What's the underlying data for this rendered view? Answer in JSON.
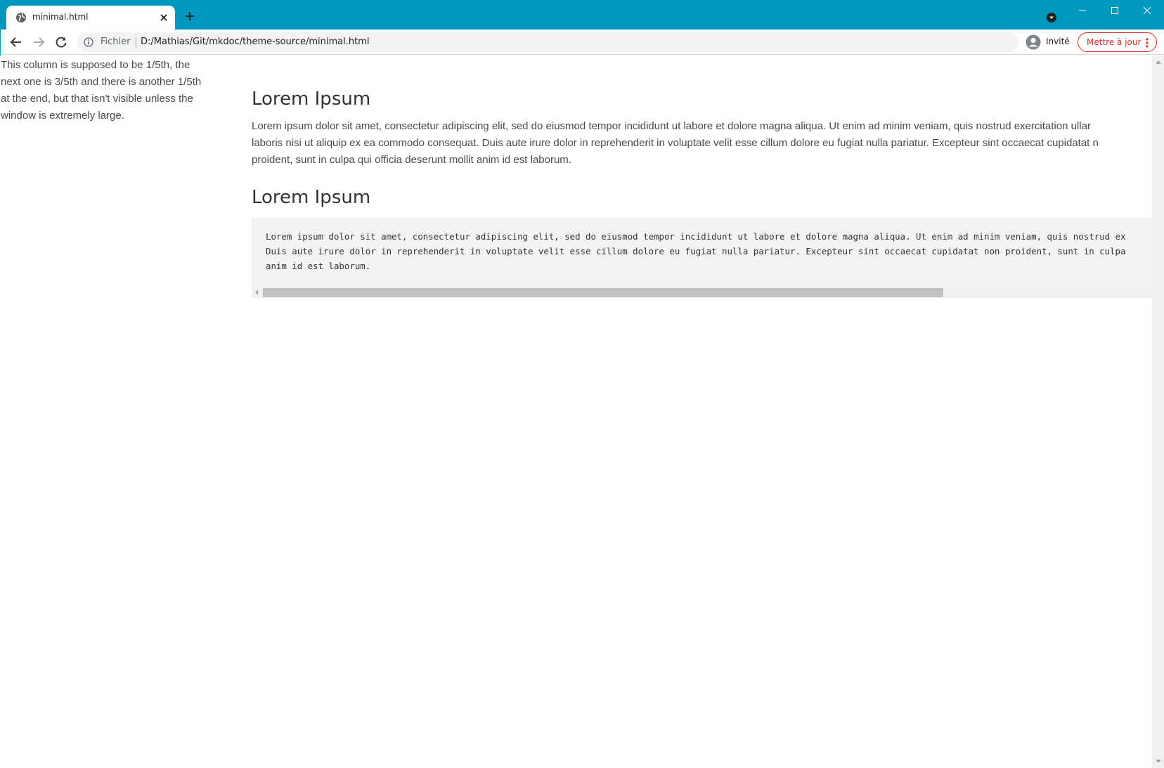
{
  "browser": {
    "tab_title": "minimal.html",
    "omnibox": {
      "scheme_label": "Fichier",
      "url": "D:/Mathias/Git/mkdoc/theme-source/minimal.html"
    },
    "profile_label": "Invité",
    "update_label": "Mettre à jour",
    "accent_color": "#0097bd",
    "update_color": "#d93025",
    "icons": [
      "globe-icon",
      "close-icon",
      "plus-icon",
      "profile-indicator-icon",
      "minimize-icon",
      "maximize-icon",
      "window-close-icon",
      "back-arrow-icon",
      "forward-arrow-icon",
      "reload-icon",
      "info-icon",
      "avatar-icon",
      "kebab-menu-icon"
    ]
  },
  "page": {
    "left_column_lines": [
      "This column is supposed to be 1/5th, the",
      "next one is 3/5th and there is another 1/5th",
      "at the end, but that isn't visible unless the",
      "window is extremely large."
    ],
    "section1": {
      "heading": "Lorem Ipsum",
      "paragraph_lines": [
        "Lorem ipsum dolor sit amet, consectetur adipiscing elit, sed do eiusmod tempor incididunt ut labore et dolore magna aliqua. Ut enim ad minim veniam, quis nostrud exercitation ullar",
        "laboris nisi ut aliquip ex ea commodo consequat. Duis aute irure dolor in reprehenderit in voluptate velit esse cillum dolore eu fugiat nulla pariatur. Excepteur sint occaecat cupidatat n",
        "proident, sunt in culpa qui officia deserunt mollit anim id est laborum."
      ]
    },
    "section2": {
      "heading": "Lorem Ipsum",
      "code_lines": [
        "Lorem ipsum dolor sit amet, consectetur adipiscing elit, sed do eiusmod tempor incididunt ut labore et dolore magna aliqua. Ut enim ad minim veniam, quis nostrud ex",
        "Duis aute irure dolor in reprehenderit in voluptate velit esse cillum dolore eu fugiat nulla pariatur. Excepteur sint occaecat cupidatat non proident, sunt in culpa",
        "anim id est laborum."
      ]
    }
  }
}
